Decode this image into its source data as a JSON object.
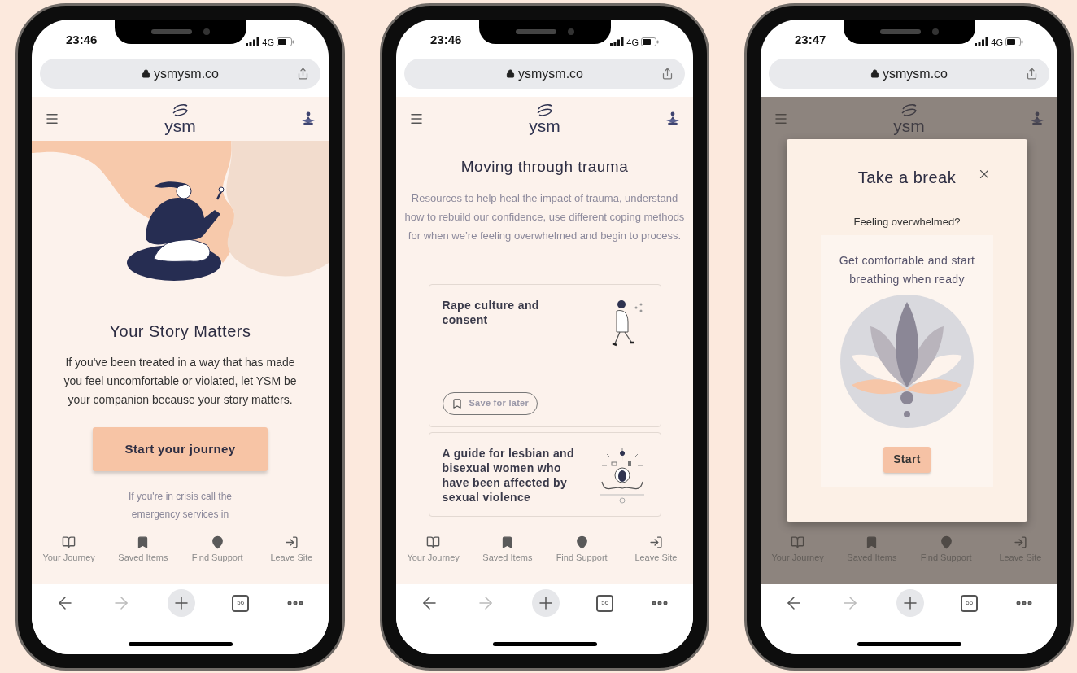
{
  "phones": [
    {
      "status_bar": {
        "time": "23:46",
        "network": "4G"
      },
      "address_bar": {
        "url": "ysmysm.co"
      },
      "header": {
        "logo": "ysm"
      },
      "screen": {
        "kind": "home",
        "title": "Your Story Matters",
        "body": "If you've been treated in a way that has made you feel uncomfortable or violated, let YSM be your companion because your story matters.",
        "button": "Start your journey",
        "note": "If you're in crisis call the emergency services in"
      },
      "bottom_nav": [
        {
          "label": "Your Journey"
        },
        {
          "label": "Saved Items"
        },
        {
          "label": "Find Support"
        },
        {
          "label": "Leave Site"
        }
      ],
      "browser_toolbar": {
        "tab_count": "56"
      }
    },
    {
      "status_bar": {
        "time": "23:46",
        "network": "4G"
      },
      "address_bar": {
        "url": "ysmysm.co"
      },
      "header": {
        "logo": "ysm"
      },
      "screen": {
        "kind": "resources",
        "title": "Moving through trauma",
        "body": "Resources to help heal the impact of trauma, understand how to rebuild our confidence, use different coping methods for when we’re feeling overwhelmed and begin to process.",
        "cards": [
          {
            "title": "Rape culture and consent",
            "save_label": "Save for later"
          },
          {
            "title": "A guide for lesbian and bisexual women who have been affected by sexual violence"
          }
        ]
      },
      "bottom_nav": [
        {
          "label": "Your Journey"
        },
        {
          "label": "Saved Items"
        },
        {
          "label": "Find Support"
        },
        {
          "label": "Leave Site"
        }
      ],
      "browser_toolbar": {
        "tab_count": "56"
      }
    },
    {
      "status_bar": {
        "time": "23:47",
        "network": "4G"
      },
      "address_bar": {
        "url": "ysmysm.co"
      },
      "header": {
        "logo": "ysm"
      },
      "screen": {
        "kind": "dialog",
        "dialog": {
          "title": "Take a break",
          "subtitle": "Feeling overwhelmed?",
          "prompt": "Get comfortable and start breathing when ready",
          "button": "Start"
        }
      },
      "bottom_nav": [
        {
          "label": "Your Journey"
        },
        {
          "label": "Saved Items"
        },
        {
          "label": "Find Support"
        },
        {
          "label": "Leave Site"
        }
      ],
      "browser_toolbar": {
        "tab_count": "56"
      }
    }
  ]
}
